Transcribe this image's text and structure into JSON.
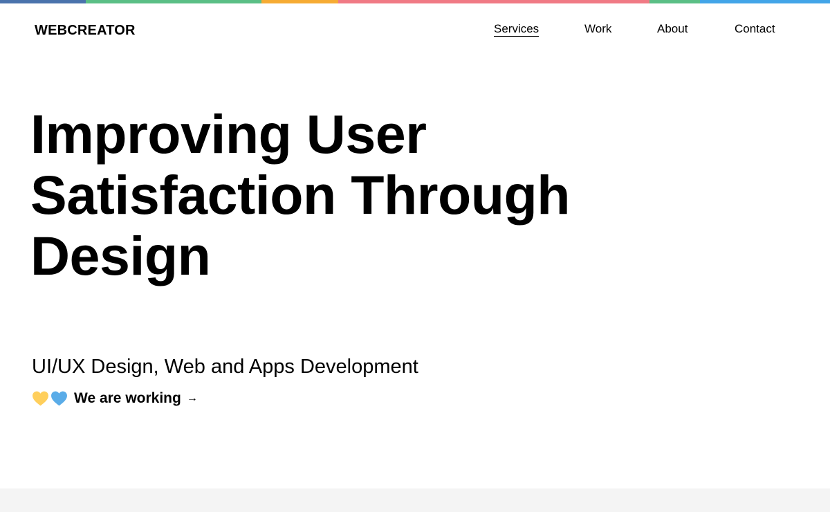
{
  "colors": {
    "strip": [
      "#4a73ac",
      "#5bbf86",
      "#f6ab33",
      "#f07a85",
      "#5bbf86",
      "#42a5e8"
    ],
    "heart_yellow": "#ffcf5c",
    "heart_blue": "#5aace8",
    "footer_band": "#f4f4f4"
  },
  "header": {
    "logo": "WEBCREATOR",
    "nav": [
      {
        "label": "Services",
        "active": true
      },
      {
        "label": "Work",
        "active": false
      },
      {
        "label": "About",
        "active": false
      },
      {
        "label": "Contact",
        "active": false
      }
    ]
  },
  "hero": {
    "title_lines": [
      "Improving User",
      "Satisfaction Through",
      "Design"
    ],
    "subtitle": "UI/UX Design, Web and Apps Development",
    "cta": {
      "icons": [
        "yellow-heart-icon",
        "blue-heart-icon"
      ],
      "label": "We are working",
      "arrow": "→"
    }
  }
}
